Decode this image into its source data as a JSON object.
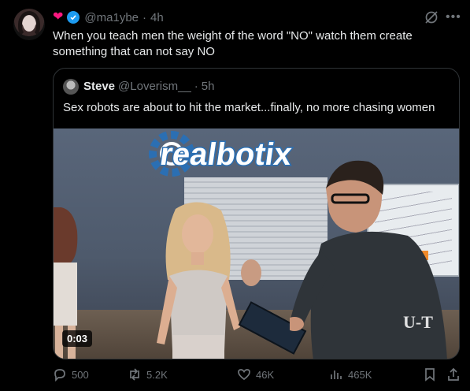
{
  "author": {
    "handle": "@ma1ybe",
    "time": "4h",
    "separator": "·",
    "badges": [
      "heart-icon",
      "verified-icon"
    ]
  },
  "tweet": {
    "text": "When you teach men the weight of the word \"NO\" watch them create something that can not say NO"
  },
  "quoted": {
    "name": "Steve",
    "handle": "@Loverism__",
    "separator": "·",
    "time": "5h",
    "text": "Sex robots are about to hit the market...finally, no more chasing women",
    "media": {
      "type": "video",
      "duration": "0:03",
      "logo_text": "realbotix",
      "watermark": "U-T"
    }
  },
  "actions": {
    "replies": "500",
    "reposts": "5.2K",
    "likes": "46K",
    "views": "465K"
  },
  "colors": {
    "background": "#000000",
    "text": "#e7e9ea",
    "muted": "#71767b",
    "border": "#2f3336",
    "verified": "#1d9bf0",
    "heart": "#f91880"
  }
}
